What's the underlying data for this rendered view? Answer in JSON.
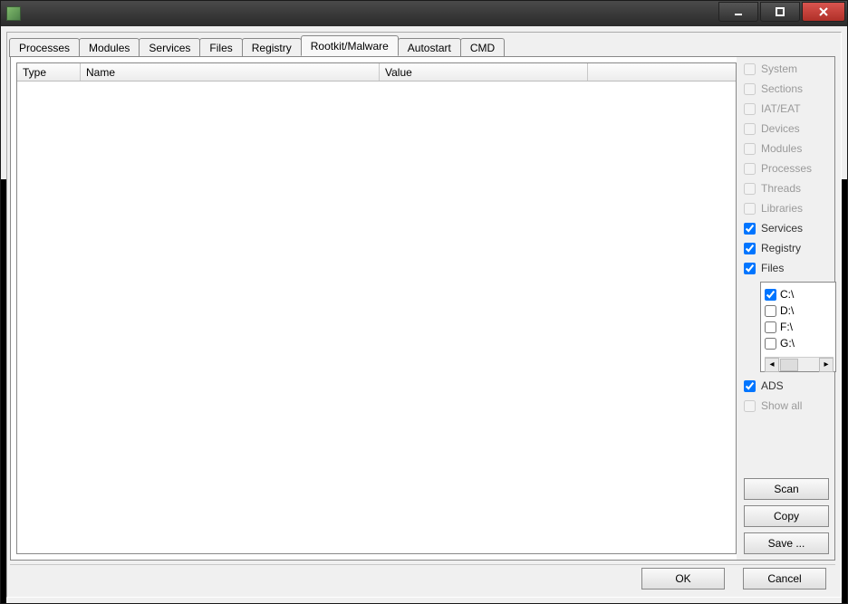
{
  "tabs": [
    "Processes",
    "Modules",
    "Services",
    "Files",
    "Registry",
    "Rootkit/Malware",
    "Autostart",
    "CMD"
  ],
  "activeTabIndex": 5,
  "columns": {
    "type": "Type",
    "name": "Name",
    "value": "Value"
  },
  "checks": {
    "system": {
      "label": "System",
      "checked": false,
      "enabled": false
    },
    "sections": {
      "label": "Sections",
      "checked": false,
      "enabled": false
    },
    "iateat": {
      "label": "IAT/EAT",
      "checked": false,
      "enabled": false
    },
    "devices": {
      "label": "Devices",
      "checked": false,
      "enabled": false
    },
    "modules": {
      "label": "Modules",
      "checked": false,
      "enabled": false
    },
    "processes": {
      "label": "Processes",
      "checked": false,
      "enabled": false
    },
    "threads": {
      "label": "Threads",
      "checked": false,
      "enabled": false
    },
    "libraries": {
      "label": "Libraries",
      "checked": false,
      "enabled": false
    },
    "services": {
      "label": "Services",
      "checked": true,
      "enabled": true
    },
    "registry": {
      "label": "Registry",
      "checked": true,
      "enabled": true
    },
    "files": {
      "label": "Files",
      "checked": true,
      "enabled": true
    },
    "ads": {
      "label": "ADS",
      "checked": true,
      "enabled": true
    },
    "showall": {
      "label": "Show all",
      "checked": false,
      "enabled": false
    }
  },
  "drives": [
    {
      "label": "C:\\",
      "checked": true
    },
    {
      "label": "D:\\",
      "checked": false
    },
    {
      "label": "F:\\",
      "checked": false
    },
    {
      "label": "G:\\",
      "checked": false
    }
  ],
  "buttons": {
    "scan": "Scan",
    "copy": "Copy",
    "save": "Save ...",
    "ok": "OK",
    "cancel": "Cancel"
  }
}
